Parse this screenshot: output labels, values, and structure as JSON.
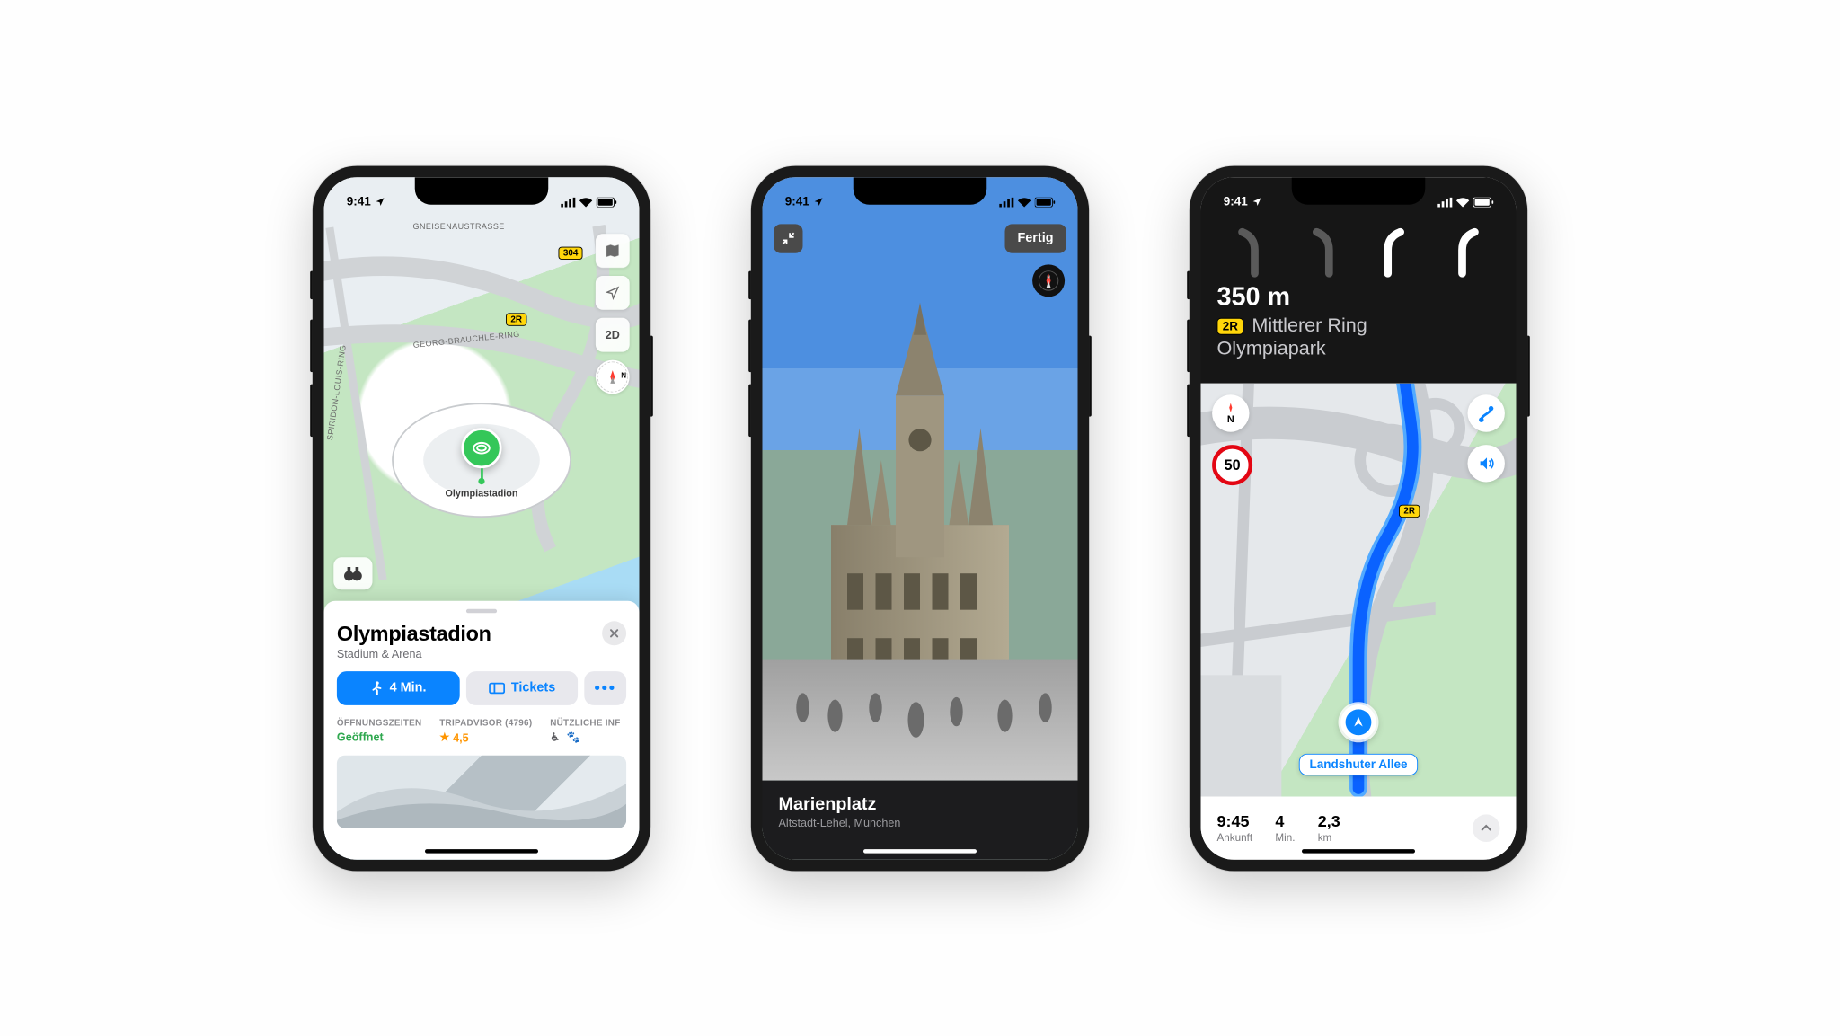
{
  "status_bar": {
    "time": "9:41"
  },
  "phone1": {
    "map": {
      "pin_label": "Olympiastadion",
      "route_badges": [
        "304",
        "2R"
      ],
      "road_names": [
        "GNEISENAUSTRASSE",
        "GEORG-BRAUCHLE-RING",
        "SPIRIDON-LOUIS-RING"
      ],
      "controls": {
        "view_mode": "2D",
        "compass": "N"
      }
    },
    "card": {
      "title": "Olympiastadion",
      "subtitle": "Stadium & Arena",
      "directions_label": "4 Min.",
      "tickets_label": "Tickets",
      "hours_header": "ÖFFNUNGSZEITEN",
      "hours_value": "Geöffnet",
      "rating_header": "TRIPADVISOR (4796)",
      "rating_value": "4,5",
      "useful_header": "NÜTZLICHE INF"
    }
  },
  "phone2": {
    "done_label": "Fertig",
    "compass": "N",
    "title": "Marienplatz",
    "subtitle": "Altstadt-Lehel, München"
  },
  "phone3": {
    "distance": "350 m",
    "route_badge": "2R",
    "dest_line1": "Mittlerer Ring",
    "dest_line2": "Olympiapark",
    "speed_limit": "50",
    "map_badge": "2R",
    "compass": "N",
    "current_street": "Landshuter Allee",
    "eta": {
      "time": "9:45",
      "time_label": "Ankunft",
      "duration": "4",
      "duration_label": "Min.",
      "distance": "2,3",
      "distance_label": "km"
    }
  }
}
